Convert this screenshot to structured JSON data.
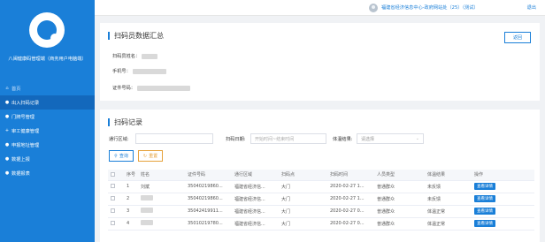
{
  "sidebar": {
    "title": "八闽健康码管理端（商务用户电脑端）",
    "items": [
      {
        "label": "首页",
        "icon": "home-icon",
        "glyph": "⌂"
      },
      {
        "label": "出入扫码记录",
        "icon": "list-icon",
        "glyph": "●"
      },
      {
        "label": "门牌号管理",
        "icon": "doorplate-icon",
        "glyph": "●"
      },
      {
        "label": "审工健康管理",
        "icon": "health-icon",
        "glyph": "+"
      },
      {
        "label": "申报地址管理",
        "icon": "address-icon",
        "glyph": "●"
      },
      {
        "label": "数据上报",
        "icon": "upload-icon",
        "glyph": "●"
      },
      {
        "label": "数据报表",
        "icon": "report-icon",
        "glyph": "●"
      }
    ]
  },
  "topbar": {
    "user_text": "福建省经济信息中心-政府网站处（25）（测试）",
    "logout_label": "退出"
  },
  "summary": {
    "title": "扫码员数据汇总",
    "back_label": "返回",
    "name_label": "扫码员姓名：",
    "phone_label": "手机号：",
    "id_label": "证件号码："
  },
  "records": {
    "title": "扫码记录",
    "region_label": "通行区域:",
    "date_label": "扫码日期:",
    "date_placeholder": "开始时间~结束时间",
    "temp_label": "体温结果:",
    "temp_placeholder": "请选择",
    "query_label": "查询",
    "reset_label": "重置",
    "columns": [
      "",
      "序号",
      "姓名",
      "证件号码",
      "通行区域",
      "扫码点",
      "扫码时间",
      "人员类型",
      "体温结果",
      "操作"
    ],
    "rows": [
      {
        "no": "1",
        "name": "刘斌",
        "id": "35040219860...",
        "region": "福建省经济信...",
        "point": "大门",
        "time": "2020-02-27 1...",
        "type": "普通群众",
        "temp": "未反馈",
        "action": "查看详情"
      },
      {
        "no": "2",
        "name": "",
        "id": "35040219860...",
        "region": "福建省经济信...",
        "point": "大门",
        "time": "2020-02-27 1...",
        "type": "普通群众",
        "temp": "未反馈",
        "action": "查看详情"
      },
      {
        "no": "3",
        "name": "",
        "id": "35042419911...",
        "region": "福建省经济信...",
        "point": "大门",
        "time": "2020-02-27 0...",
        "type": "普通群众",
        "temp": "体温正常",
        "action": "查看详情"
      },
      {
        "no": "4",
        "name": "",
        "id": "35010219780...",
        "region": "福建省经济信...",
        "point": "大门",
        "time": "2020-02-27 0...",
        "type": "普通群众",
        "temp": "体温正常",
        "action": "查看详情"
      }
    ]
  }
}
